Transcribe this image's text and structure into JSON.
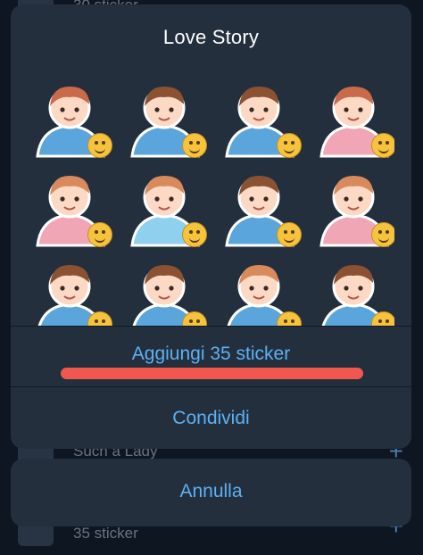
{
  "background": {
    "rows": [
      {
        "text": "30 sticker"
      },
      {
        "text": "Such a Lady"
      },
      {
        "text": "35 sticker"
      }
    ],
    "plus_glyph": "+"
  },
  "sheet": {
    "title": "Love Story",
    "stickers": [
      {
        "name": "couple-laughing",
        "badge": "laughing-emoji",
        "hair": "#c96a4b",
        "shirt": "#5aa6dc"
      },
      {
        "name": "boy-blowing-kiss",
        "badge": "kiss-emoji",
        "hair": "#8a5232",
        "shirt": "#5aa6dc"
      },
      {
        "name": "boy-shocked",
        "badge": "fearful-emoji",
        "hair": "#8a5232",
        "shirt": "#5aa6dc"
      },
      {
        "name": "couple-thumbs-up",
        "badge": "thumbs-up-emoji",
        "hair": "#c96a4b",
        "shirt": "#f1a6b5"
      },
      {
        "name": "girl-waving",
        "badge": "waving-hand-emoji",
        "hair": "#d98a5c",
        "shirt": "#f1a6b5"
      },
      {
        "name": "girl-shrugging",
        "badge": "shrug-emoji",
        "hair": "#d98a5c",
        "shirt": "#8fd0ee"
      },
      {
        "name": "boy-thinking",
        "badge": "thinking-emoji",
        "hair": "#8a5232",
        "shirt": "#5aa6dc"
      },
      {
        "name": "girl-framed-angry",
        "badge": "angry-emoji",
        "hair": "#d98a5c",
        "shirt": "#f1a6b5"
      },
      {
        "name": "couple-heart",
        "badge": "heart-emoji",
        "hair": "#8a5232",
        "shirt": "#5aa6dc"
      },
      {
        "name": "boy-arrow-heart-eyes",
        "badge": "heart-eyes-emoji",
        "hair": "#8a5232",
        "shirt": "#5aa6dc"
      },
      {
        "name": "girl-kissing-boy",
        "badge": "smiling-emoji",
        "hair": "#d98a5c",
        "shirt": "#5aa6dc"
      },
      {
        "name": "couple-cinema",
        "badge": "popcorn-emoji",
        "hair": "#8a5232",
        "shirt": "#5aa6dc"
      }
    ],
    "add_label": "Aggiungi 35 sticker",
    "share_label": "Condividi"
  },
  "cancel_label": "Annulla",
  "colors": {
    "sheet_bg": "#232f3d",
    "accent": "#5eb0f3",
    "highlight_bar": "#f0584f",
    "background": "#0e1621"
  }
}
